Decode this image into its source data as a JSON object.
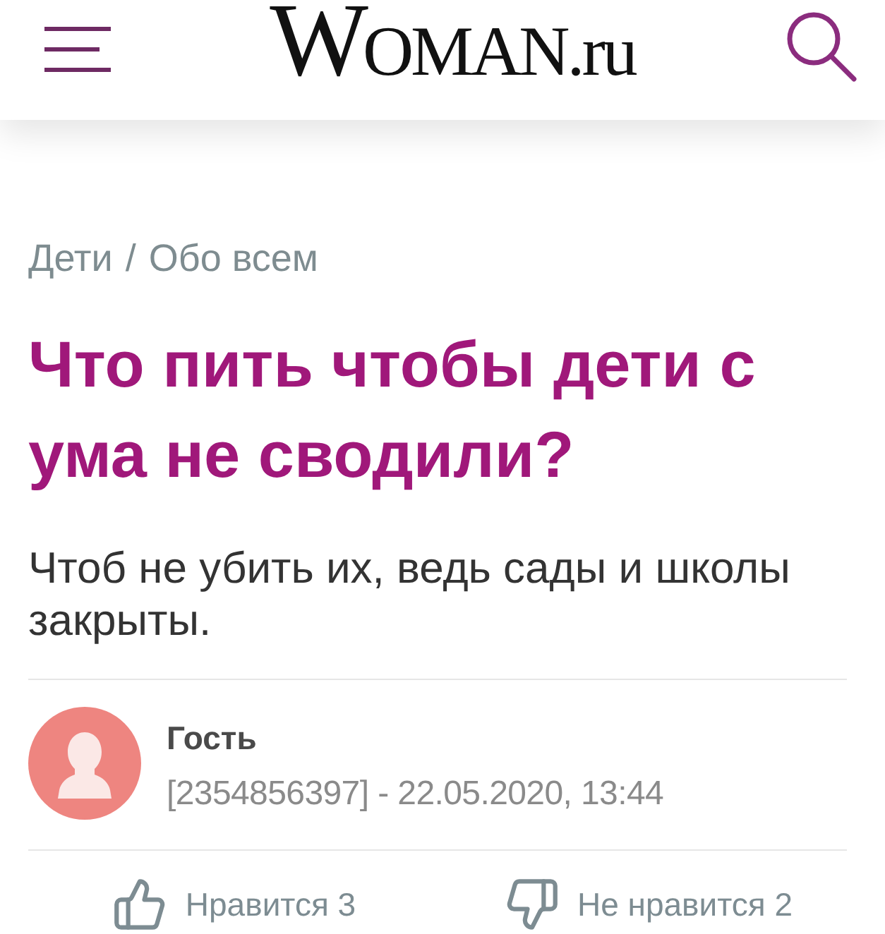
{
  "header": {
    "logo": "WOMAN.ru"
  },
  "breadcrumb": {
    "items": [
      "Дети",
      "Обо всем"
    ],
    "separator": "/"
  },
  "topic": {
    "title": "Что пить чтобы дети с ума не сводили?",
    "text": "Чтоб не убить их, ведь сады и школы закрыты."
  },
  "author": {
    "name": "Гость",
    "meta": "[2354856397] - 22.05.2020, 13:44"
  },
  "reactions": [
    {
      "kind": "like",
      "label": "Нравится 3"
    },
    {
      "kind": "dislike",
      "label": "Не нравится 2"
    }
  ]
}
